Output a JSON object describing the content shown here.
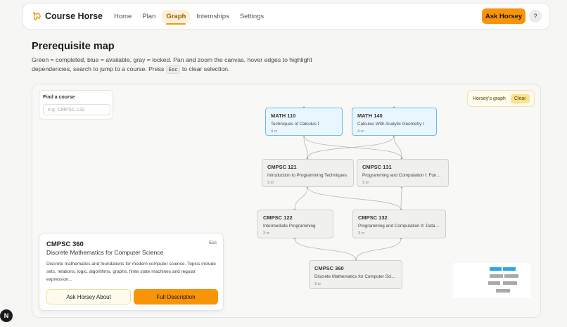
{
  "nav": {
    "brand": "Course Horse",
    "links": [
      {
        "label": "Home"
      },
      {
        "label": "Plan"
      },
      {
        "label": "Graph"
      },
      {
        "label": "Internships"
      },
      {
        "label": "Settings"
      }
    ],
    "active_link": "Graph",
    "ask_button": "Ask Horsey",
    "help_label": "?"
  },
  "page": {
    "title": "Prerequisite map",
    "description_1": "Green = completed, blue = available, gray = locked. Pan and zoom the canvas, hover edges to highlight dependencies, search to jump to a course. Press ",
    "description_key": "Esc",
    "description_2": " to clear selection."
  },
  "search": {
    "label": "Find a course",
    "placeholder": "e.g. CMPSC 132",
    "value": ""
  },
  "graph_badge": {
    "label": "Horsey's graph",
    "clear_label": "Clear"
  },
  "nodes": [
    {
      "code": "MATH 110",
      "title": "Techniques of Calculus I",
      "credits": "4 cr",
      "status": "available"
    },
    {
      "code": "MATH 140",
      "title": "Calculus With Analytic Geometry I",
      "credits": "4 cr",
      "status": "available"
    },
    {
      "code": "CMPSC 121",
      "title": "Introduction to Programming Techniques",
      "credits": "3 cr",
      "status": "locked"
    },
    {
      "code": "CMPSC 131",
      "title": "Programming and Computation I: Fundamentals",
      "credits": "3 cr",
      "status": "locked"
    },
    {
      "code": "CMPSC 122",
      "title": "Intermediate Programming",
      "credits": "3 cr",
      "status": "locked"
    },
    {
      "code": "CMPSC 132",
      "title": "Programming and Computation II: Data Structures",
      "credits": "3 cr",
      "status": "locked"
    },
    {
      "code": "CMPSC 360",
      "title": "Discrete Mathematics for Computer Science",
      "credits": "3 cr",
      "status": "locked"
    }
  ],
  "colors": {
    "accent": "#f7940a",
    "available_border": "#5fc0ee",
    "available_fill": "#eaf6fd",
    "locked_border": "#cfcfcc",
    "locked_fill": "#f0f0ef",
    "minimap_available": "#2aa8e6",
    "minimap_locked": "#a9a9a9"
  },
  "detail": {
    "code": "CMPSC 360",
    "esc_label": "Esc",
    "title": "Discrete Mathematics for Computer Science",
    "description": "Discrete mathematics and foundations for modern computer science. Topics include sets, relations, logic, algorithms, graphs, finite state machines and regular expression...",
    "ask_button": "Ask Horsey About",
    "full_button": "Full Description"
  },
  "badge": {
    "label": "N"
  },
  "icons": {
    "brand": "horse-logo-icon",
    "minimap": "minimap"
  }
}
